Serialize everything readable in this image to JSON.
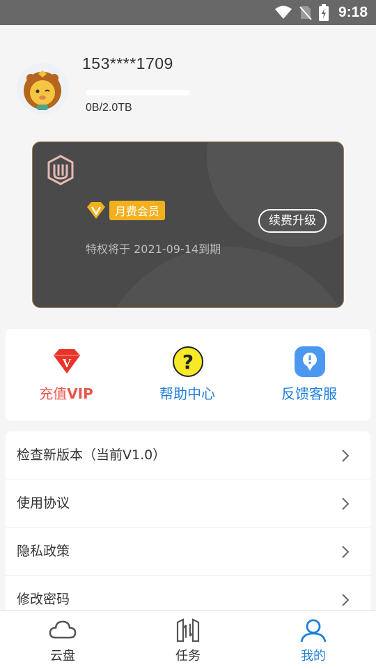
{
  "status_bar": {
    "time": "9:18"
  },
  "profile": {
    "username": "153****1709",
    "storage_text": "0B/2.0TB",
    "storage_used_fraction": 0
  },
  "vip_card": {
    "member_label": "月费会员",
    "expire_text": "特权将于 2021-09-14到期",
    "renew_button": "续费升级"
  },
  "quick_actions": [
    {
      "label": "充值",
      "label_bold": "VIP",
      "color": "#e9564a",
      "icon": "diamond-v-icon"
    },
    {
      "label": "帮助中心",
      "color": "#1e7fd9",
      "icon": "question-icon"
    },
    {
      "label": "反馈客服",
      "color": "#1e7fd9",
      "icon": "lightbulb-chat-icon"
    }
  ],
  "menu": [
    {
      "label": "检查新版本（当前V1.0）"
    },
    {
      "label": "使用协议"
    },
    {
      "label": "隐私政策"
    },
    {
      "label": "修改密码"
    }
  ],
  "bottom_nav": [
    {
      "label": "云盘",
      "icon": "cloud-icon",
      "active": false
    },
    {
      "label": "任务",
      "icon": "task-icon",
      "active": false
    },
    {
      "label": "我的",
      "icon": "user-icon",
      "active": true
    }
  ],
  "colors": {
    "accent": "#1e7fd9",
    "vip_gold": "#f2b01e",
    "card_bg": "#4a4a4a"
  }
}
